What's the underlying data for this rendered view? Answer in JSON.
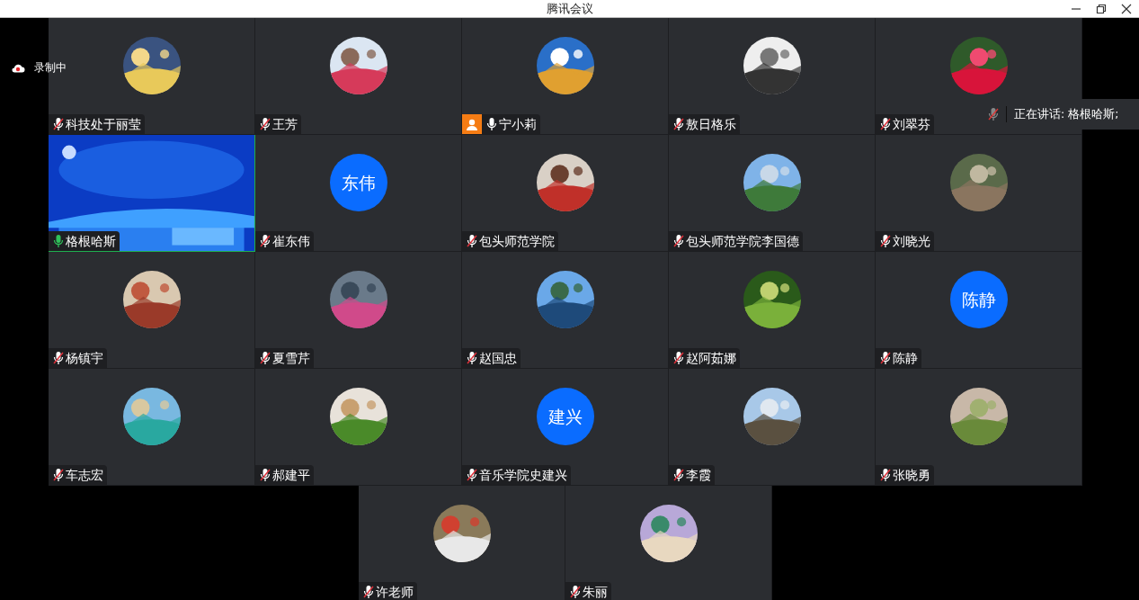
{
  "window": {
    "title": "腾讯会议"
  },
  "recording": {
    "label": "录制中"
  },
  "speaking": {
    "label": "正在讲话: 格根哈斯;"
  },
  "rows": [
    [
      {
        "name": "科技处于丽莹",
        "kind": "picture",
        "muted": true,
        "speaking": false,
        "host": false
      },
      {
        "name": "王芳",
        "kind": "picture",
        "muted": true,
        "speaking": false,
        "host": false
      },
      {
        "name": "宁小莉",
        "kind": "picture",
        "muted": false,
        "speaking": false,
        "host": true
      },
      {
        "name": "敖日格乐",
        "kind": "picture",
        "muted": true,
        "speaking": false,
        "host": false
      },
      {
        "name": "刘翠芬",
        "kind": "picture",
        "muted": true,
        "speaking": false,
        "host": false
      }
    ],
    [
      {
        "name": "格根哈斯",
        "kind": "video",
        "muted": false,
        "speaking": true,
        "host": false
      },
      {
        "name": "崔东伟",
        "kind": "initials",
        "initials": "东伟",
        "muted": true,
        "speaking": false,
        "host": false
      },
      {
        "name": "包头师范学院",
        "kind": "picture",
        "muted": true,
        "speaking": false,
        "host": false
      },
      {
        "name": "包头师范学院李国德",
        "kind": "picture",
        "muted": true,
        "speaking": false,
        "host": false
      },
      {
        "name": "刘晓光",
        "kind": "picture",
        "muted": true,
        "speaking": false,
        "host": false
      }
    ],
    [
      {
        "name": "杨镇宇",
        "kind": "picture",
        "muted": true,
        "speaking": false,
        "host": false
      },
      {
        "name": "夏雪芹",
        "kind": "picture",
        "muted": true,
        "speaking": false,
        "host": false
      },
      {
        "name": "赵国忠",
        "kind": "picture",
        "muted": true,
        "speaking": false,
        "host": false
      },
      {
        "name": "赵阿茹娜",
        "kind": "picture",
        "muted": true,
        "speaking": false,
        "host": false
      },
      {
        "name": "陈静",
        "kind": "initials",
        "initials": "陈静",
        "muted": true,
        "speaking": false,
        "host": false
      }
    ],
    [
      {
        "name": "车志宏",
        "kind": "picture",
        "muted": true,
        "speaking": false,
        "host": false
      },
      {
        "name": "郝建平",
        "kind": "picture",
        "muted": true,
        "speaking": false,
        "host": false
      },
      {
        "name": "音乐学院史建兴",
        "kind": "initials",
        "initials": "建兴",
        "muted": true,
        "speaking": false,
        "host": false
      },
      {
        "name": "李霞",
        "kind": "picture",
        "muted": true,
        "speaking": false,
        "host": false
      },
      {
        "name": "张晓勇",
        "kind": "picture",
        "muted": true,
        "speaking": false,
        "host": false
      }
    ],
    [
      {
        "name": "许老师",
        "kind": "picture",
        "muted": true,
        "speaking": false,
        "host": false
      },
      {
        "name": "朱丽",
        "kind": "picture",
        "muted": true,
        "speaking": false,
        "host": false
      }
    ]
  ]
}
